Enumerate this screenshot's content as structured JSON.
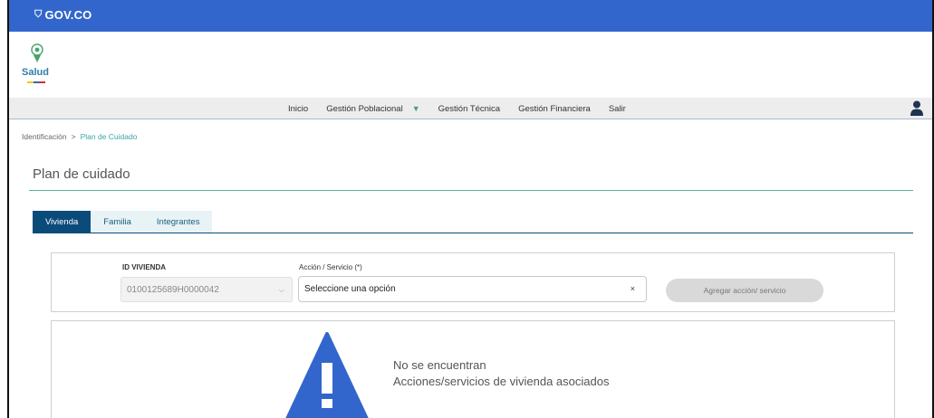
{
  "gov_bar": {
    "logo_text": "GOV.CO",
    "color": "#3366cc"
  },
  "brand": {
    "name": "Salud",
    "stripe_colors": [
      "#f5c400",
      "#2a66c4",
      "#d62d2d"
    ]
  },
  "nav": {
    "items": [
      {
        "label": "Inicio"
      },
      {
        "label": "Gestión Poblacional",
        "has_dropdown": true
      },
      {
        "label": "Gestión Técnica"
      },
      {
        "label": "Gestión Financiera"
      },
      {
        "label": "Salir"
      }
    ],
    "user_icon": "user-icon"
  },
  "breadcrumb": {
    "root": "Identificación",
    "separator": ">",
    "current": "Plan de Cuidado"
  },
  "page": {
    "title": "Plan de cuidado",
    "accent_color": "#55b9a4"
  },
  "tabs": [
    {
      "label": "Vivienda",
      "active": true
    },
    {
      "label": "Familia",
      "active": false
    },
    {
      "label": "Integrantes",
      "active": false
    }
  ],
  "form": {
    "id_label": "ID VIVIENDA",
    "id_value": "0100125689H0000042",
    "accion_label": "Acción / Servicio (*)",
    "accion_value": "Seleccione una opción",
    "clear_symbol": "×",
    "add_button": "Agregar acción/ servicio"
  },
  "empty_state": {
    "icon": "warning-icon",
    "line1": "No se encuentran",
    "line2": "Acciones/servicios de vivienda asociados",
    "icon_color": "#3366cc"
  }
}
